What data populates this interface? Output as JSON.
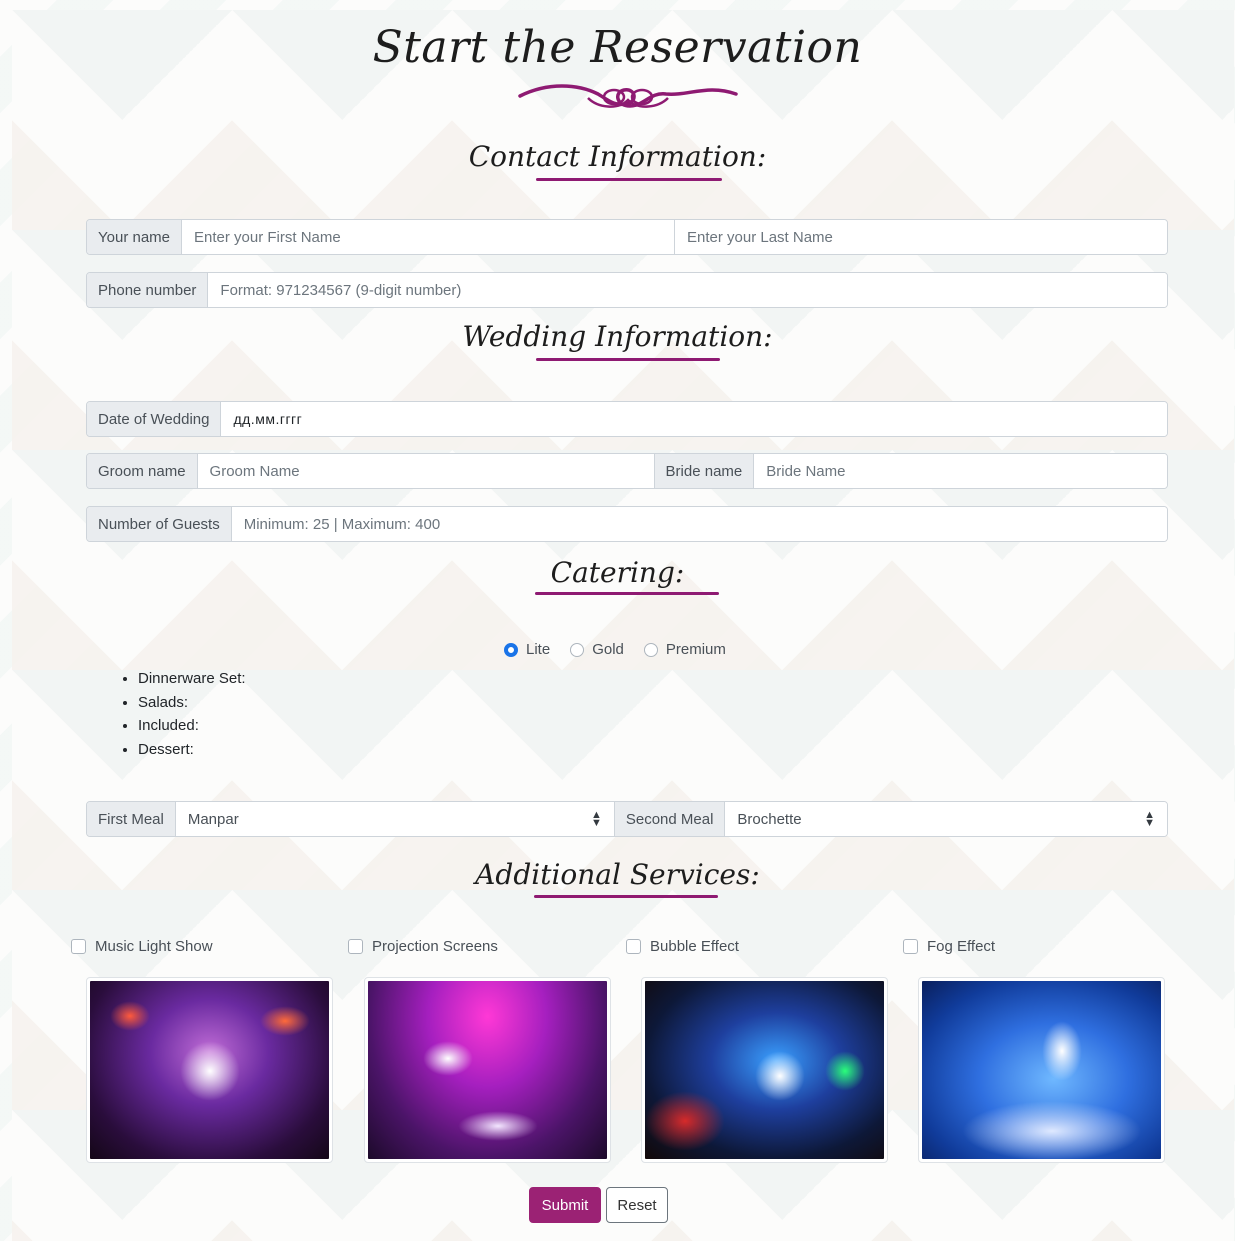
{
  "page": {
    "title": "Start the Reservation",
    "accent_color": "#8e1a72",
    "submit_color": "#9b2274"
  },
  "contact": {
    "title": "Contact Information:",
    "name_label": "Your name",
    "first_placeholder": "Enter your First Name",
    "last_placeholder": "Enter your Last Name",
    "phone_label": "Phone number",
    "phone_placeholder": "Format: 971234567 (9-digit number)"
  },
  "wedding": {
    "title": "Wedding Information:",
    "date_label": "Date of Wedding",
    "date_value": "дд.мм.гггг",
    "groom_label": "Groom name",
    "groom_placeholder": "Groom Name",
    "bride_label": "Bride name",
    "bride_placeholder": "Bride Name",
    "guests_label": "Number of Guests",
    "guests_placeholder": "Minimum: 25 | Maximum: 400"
  },
  "catering": {
    "title": "Catering:",
    "options": [
      {
        "label": "Lite",
        "selected": true
      },
      {
        "label": "Gold",
        "selected": false
      },
      {
        "label": "Premium",
        "selected": false
      }
    ],
    "details": [
      "Dinnerware Set:",
      "Salads:",
      "Included:",
      "Dessert:"
    ],
    "first_meal_label": "First Meal",
    "first_meal_value": "Manpar",
    "second_meal_label": "Second Meal",
    "second_meal_value": "Brochette"
  },
  "additional": {
    "title": "Additional Services:",
    "services": [
      {
        "label": "Music Light Show",
        "checked": false,
        "image_icon": "concert-stage-photo"
      },
      {
        "label": "Projection Screens",
        "checked": false,
        "image_icon": "banquet-hall-photo"
      },
      {
        "label": "Bubble Effect",
        "checked": false,
        "image_icon": "bubble-party-photo"
      },
      {
        "label": "Fog Effect",
        "checked": false,
        "image_icon": "wedding-dance-fog-photo"
      }
    ]
  },
  "actions": {
    "submit_label": "Submit",
    "reset_label": "Reset"
  }
}
